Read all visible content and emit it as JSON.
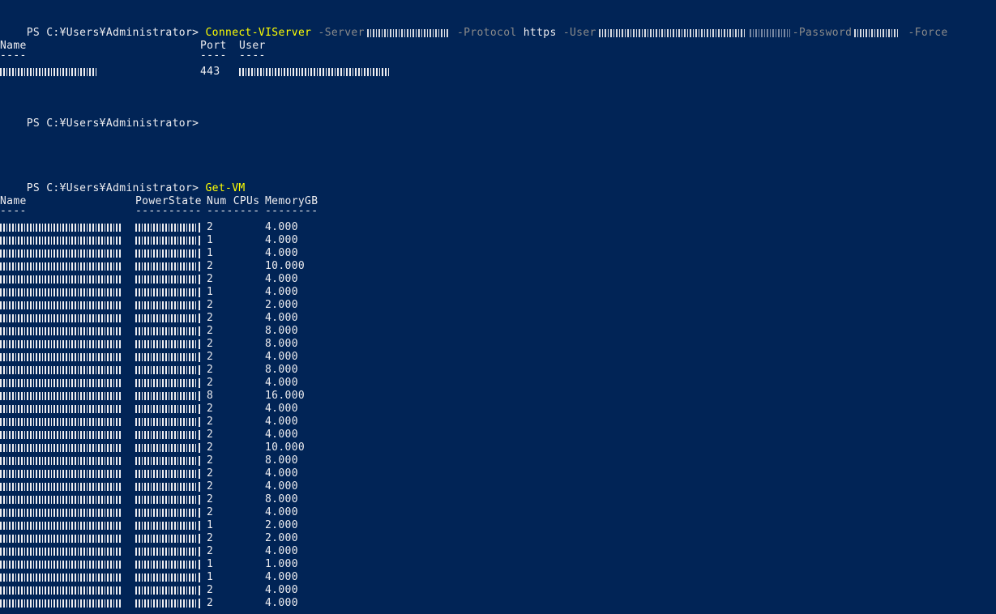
{
  "prompt": "PS C:¥Users¥Administrator>",
  "cmd1": {
    "name": "Connect-VIServer",
    "server_flag": "-Server",
    "protocol_flag": "-Protocol",
    "protocol_value": "https",
    "user_flag": "-User",
    "password_flag": "-Password",
    "force_flag": "-Force",
    "redacted": true
  },
  "conn_table": {
    "headers": [
      "Name",
      "Port",
      "User"
    ],
    "underlines": [
      "----",
      "----",
      "----"
    ],
    "row": {
      "name_redacted": true,
      "port": "443",
      "user_redacted": true
    }
  },
  "cmd2": {
    "name": "Get-VM"
  },
  "vm_table": {
    "headers": [
      "Name",
      "PowerState",
      "Num CPUs",
      "MemoryGB"
    ],
    "underlines": [
      "----",
      "----------",
      "--------",
      "--------"
    ],
    "rows": [
      {
        "cpus": "2",
        "mem": "4.000"
      },
      {
        "cpus": "1",
        "mem": "4.000"
      },
      {
        "cpus": "1",
        "mem": "4.000"
      },
      {
        "cpus": "2",
        "mem": "10.000"
      },
      {
        "cpus": "2",
        "mem": "4.000"
      },
      {
        "cpus": "1",
        "mem": "4.000"
      },
      {
        "cpus": "2",
        "mem": "2.000"
      },
      {
        "cpus": "2",
        "mem": "4.000"
      },
      {
        "cpus": "2",
        "mem": "8.000"
      },
      {
        "cpus": "2",
        "mem": "8.000"
      },
      {
        "cpus": "2",
        "mem": "4.000"
      },
      {
        "cpus": "2",
        "mem": "8.000"
      },
      {
        "cpus": "2",
        "mem": "4.000"
      },
      {
        "cpus": "8",
        "mem": "16.000"
      },
      {
        "cpus": "2",
        "mem": "4.000"
      },
      {
        "cpus": "2",
        "mem": "4.000"
      },
      {
        "cpus": "2",
        "mem": "4.000"
      },
      {
        "cpus": "2",
        "mem": "10.000"
      },
      {
        "cpus": "2",
        "mem": "8.000"
      },
      {
        "cpus": "2",
        "mem": "4.000"
      },
      {
        "cpus": "2",
        "mem": "4.000"
      },
      {
        "cpus": "2",
        "mem": "8.000"
      },
      {
        "cpus": "2",
        "mem": "4.000"
      },
      {
        "cpus": "1",
        "mem": "2.000"
      },
      {
        "cpus": "2",
        "mem": "2.000"
      },
      {
        "cpus": "2",
        "mem": "4.000"
      },
      {
        "cpus": "1",
        "mem": "1.000"
      },
      {
        "cpus": "1",
        "mem": "4.000"
      },
      {
        "cpus": "2",
        "mem": "4.000"
      },
      {
        "cpus": "2",
        "mem": "4.000"
      }
    ]
  },
  "colors": {
    "background": "#012456",
    "text": "#eeedf0",
    "command": "#ffff00",
    "parameter": "#8a8a8a"
  }
}
